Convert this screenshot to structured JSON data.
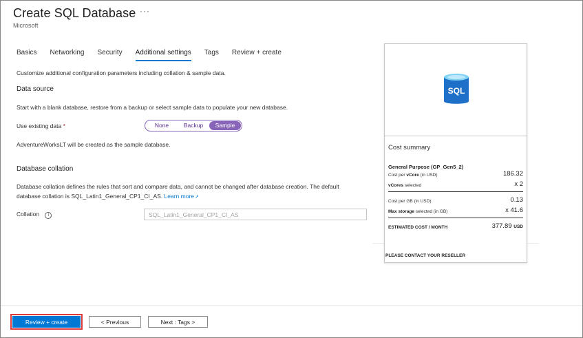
{
  "header": {
    "title": "Create SQL Database",
    "more": "···",
    "subtitle": "Microsoft"
  },
  "tabs": [
    {
      "label": "Basics",
      "active": false
    },
    {
      "label": "Networking",
      "active": false
    },
    {
      "label": "Security",
      "active": false
    },
    {
      "label": "Additional settings",
      "active": true
    },
    {
      "label": "Tags",
      "active": false
    },
    {
      "label": "Review + create",
      "active": false
    }
  ],
  "intro": "Customize additional configuration parameters including collation & sample data.",
  "data_source": {
    "heading": "Data source",
    "description": "Start with a blank database, restore from a backup or select sample data to populate your new database.",
    "field_label": "Use existing data",
    "required_mark": "*",
    "options": [
      "None",
      "Backup",
      "Sample"
    ],
    "selected": "Sample",
    "note": "AdventureWorksLT will be created as the sample database."
  },
  "collation": {
    "heading": "Database collation",
    "description_line1": "Database collation defines the rules that sort and compare data, and cannot be changed after database creation. The default",
    "description_line2": "database collation is SQL_Latin1_General_CP1_CI_AS.",
    "learn_more": "Learn more",
    "field_label": "Collation",
    "info_glyph": "i",
    "value": "SQL_Latin1_General_CP1_CI_AS"
  },
  "cost_card": {
    "icon_label": "SQL",
    "summary_label": "Cost summary",
    "tier": "General Purpose (GP_Gen5_2)",
    "cost_per_vcore_label": "Cost per ",
    "cost_per_vcore_bold": "vCore",
    "cost_per_vcore_unit": " (in USD)",
    "cost_per_vcore_value": "186.32",
    "vcores_bold": "vCores",
    "vcores_label": " selected",
    "vcores_value": "x 2",
    "cost_per_gb_label": "Cost per GB",
    "cost_per_gb_unit": " (in USD)",
    "cost_per_gb_value": "0.13",
    "max_storage_bold": "Max storage",
    "max_storage_label": " selected (in GB)",
    "max_storage_value": "x 41.6",
    "estimated_label": "ESTIMATED COST / MONTH",
    "estimated_value": "377.89",
    "estimated_currency": "USD",
    "contact": "PLEASE CONTACT YOUR RESELLER"
  },
  "footer": {
    "review_create": "Review + create",
    "previous": "< Previous",
    "next": "Next : Tags >"
  },
  "colors": {
    "primary": "#0078d4",
    "segment_accent": "#8764b8",
    "highlight_outline": "#e03b3b",
    "required": "#a4262c"
  }
}
